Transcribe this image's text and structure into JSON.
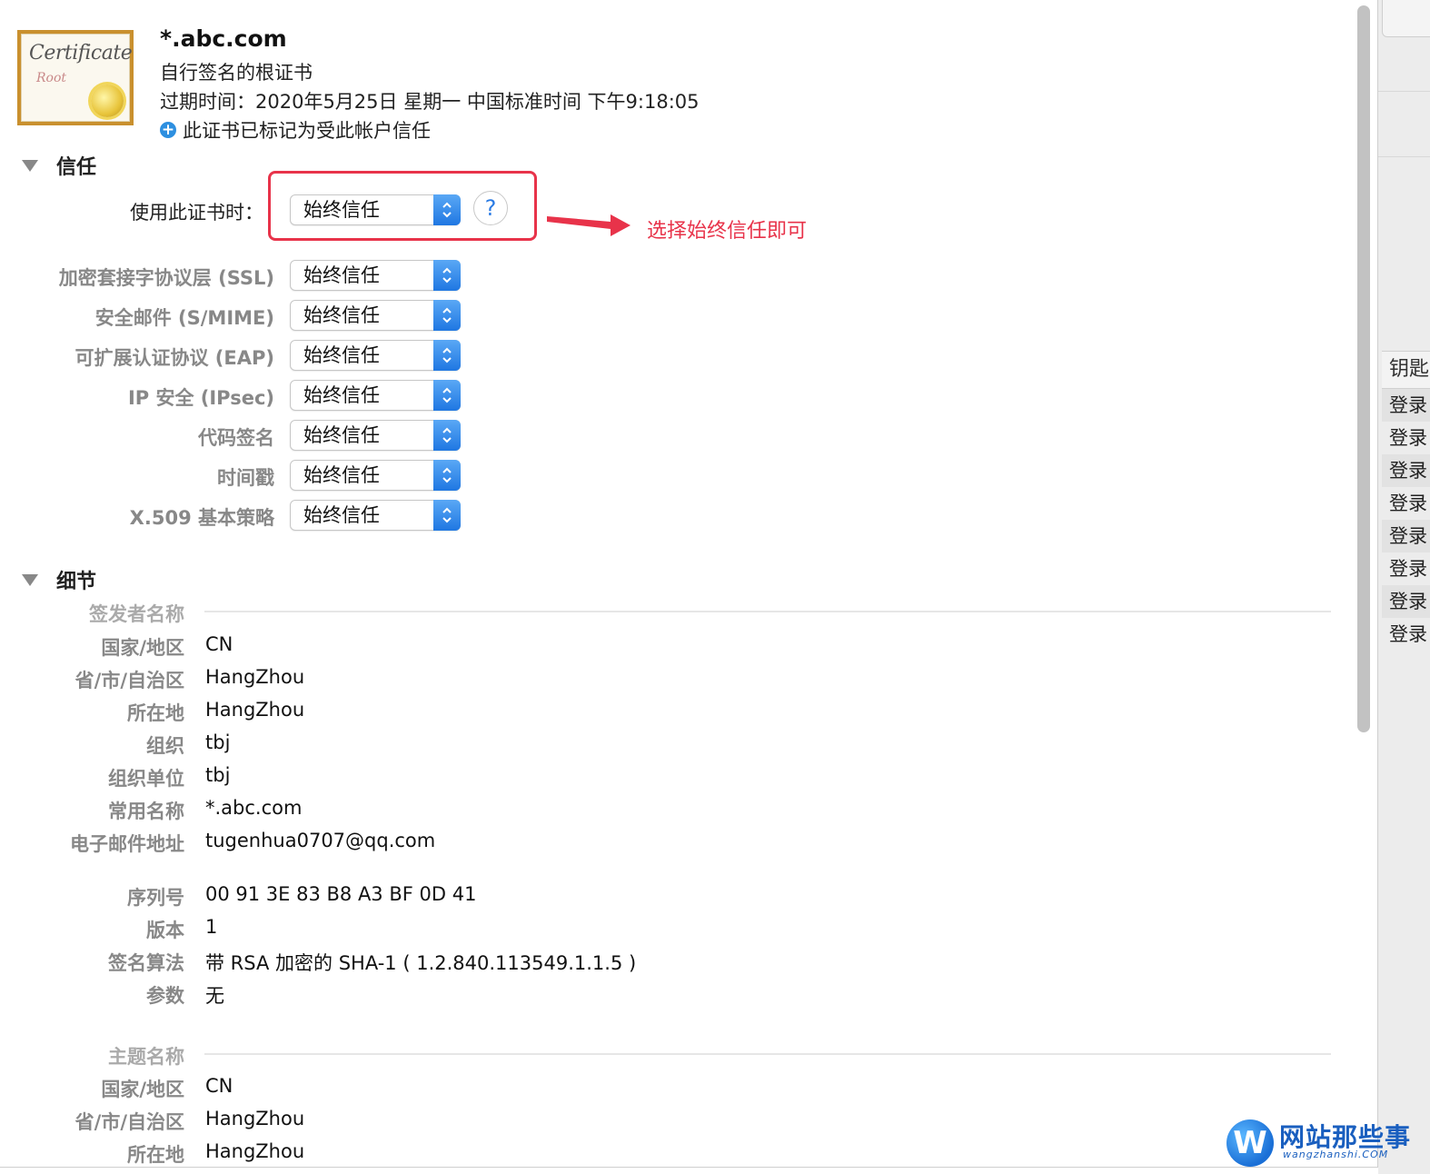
{
  "header": {
    "title": "*.abc.com",
    "subtitle": "自行签名的根证书",
    "expiry": "过期时间：2020年5月25日 星期一 中国标准时间 下午9:18:05",
    "trust_note": "此证书已标记为受此帐户信任",
    "cert_icon_text": "Certificate",
    "cert_icon_sub": "Root"
  },
  "trust": {
    "section_label": "信任",
    "main_label": "使用此证书时：",
    "main_value": "始终信任",
    "help_label": "?",
    "rows": [
      {
        "label": "加密套接字协议层 (SSL)",
        "value": "始终信任"
      },
      {
        "label": "安全邮件 (S/MIME)",
        "value": "始终信任"
      },
      {
        "label": "可扩展认证协议 (EAP)",
        "value": "始终信任"
      },
      {
        "label": "IP 安全 (IPsec)",
        "value": "始终信任"
      },
      {
        "label": "代码签名",
        "value": "始终信任"
      },
      {
        "label": "时间戳",
        "value": "始终信任"
      },
      {
        "label": "X.509 基本策略",
        "value": "始终信任"
      }
    ]
  },
  "annotation": {
    "text": "选择始终信任即可",
    "color": "#e8334a"
  },
  "details": {
    "section_label": "细节",
    "issuer": {
      "title": "签发者名称",
      "rows": [
        {
          "label": "国家/地区",
          "value": "CN"
        },
        {
          "label": "省/市/自治区",
          "value": "HangZhou"
        },
        {
          "label": "所在地",
          "value": "HangZhou"
        },
        {
          "label": "组织",
          "value": "tbj"
        },
        {
          "label": "组织单位",
          "value": "tbj"
        },
        {
          "label": "常用名称",
          "value": "*.abc.com"
        },
        {
          "label": "电子邮件地址",
          "value": "tugenhua0707@qq.com"
        }
      ]
    },
    "meta": [
      {
        "label": "序列号",
        "value": "00 91 3E 83 B8 A3 BF 0D 41"
      },
      {
        "label": "版本",
        "value": "1"
      },
      {
        "label": "签名算法",
        "value": "带 RSA 加密的 SHA-1 ( 1.2.840.113549.1.1.5 )"
      },
      {
        "label": "参数",
        "value": "无"
      }
    ],
    "subject": {
      "title": "主题名称",
      "rows": [
        {
          "label": "国家/地区",
          "value": "CN"
        },
        {
          "label": "省/市/自治区",
          "value": "HangZhou"
        },
        {
          "label": "所在地",
          "value": "HangZhou"
        }
      ]
    }
  },
  "side_panel": {
    "header": "钥匙",
    "rows": [
      "登录",
      "登录",
      "登录",
      "登录",
      "登录",
      "登录",
      "登录",
      "登录"
    ]
  },
  "watermark": {
    "logo": "W",
    "name": "网站那些事",
    "url": "wangzhanshi.COM"
  }
}
